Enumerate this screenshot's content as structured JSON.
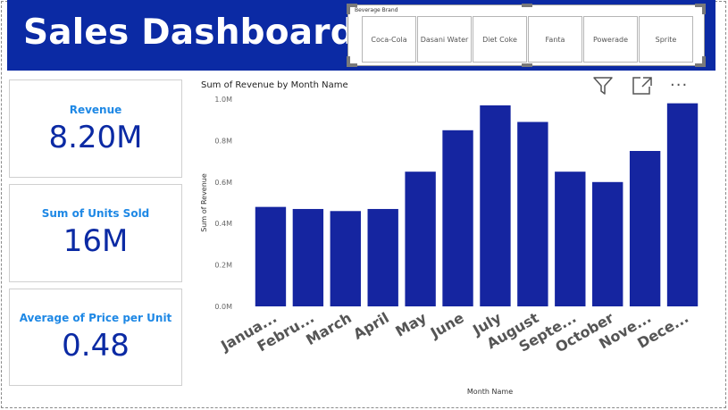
{
  "header": {
    "title": "Sales Dashboard",
    "background": "#0b2aa4"
  },
  "slicer": {
    "title": "Beverage Brand",
    "items": [
      "Coca-Cola",
      "Dasani Water",
      "Diet Coke",
      "Fanta",
      "Powerade",
      "Sprite"
    ]
  },
  "cards": [
    {
      "label": "Revenue",
      "value": "8.20M"
    },
    {
      "label": "Sum of Units Sold",
      "value": "16M"
    },
    {
      "label": "Average of Price per Unit",
      "value": "0.48"
    }
  ],
  "visual_header": {
    "icons": [
      "filter-icon",
      "focus-mode-icon",
      "more-options-icon"
    ],
    "more_label": "..."
  },
  "chart_data": {
    "type": "bar",
    "title": "Sum of Revenue by Month Name",
    "xlabel": "Month Name",
    "ylabel": "Sum of Revenue",
    "categories": [
      "Janua...",
      "Febru...",
      "March",
      "April",
      "May",
      "June",
      "July",
      "August",
      "Septe...",
      "October",
      "Nove...",
      "Dece..."
    ],
    "values": [
      0.48,
      0.47,
      0.46,
      0.47,
      0.65,
      0.85,
      0.97,
      0.89,
      0.65,
      0.6,
      0.75,
      0.98
    ],
    "value_unit": "M",
    "ylim": [
      0,
      1.0
    ],
    "yticks": [
      "0.0M",
      "0.2M",
      "0.4M",
      "0.6M",
      "0.8M",
      "1.0M"
    ],
    "grid": false,
    "bar_color": "#1525a0"
  }
}
